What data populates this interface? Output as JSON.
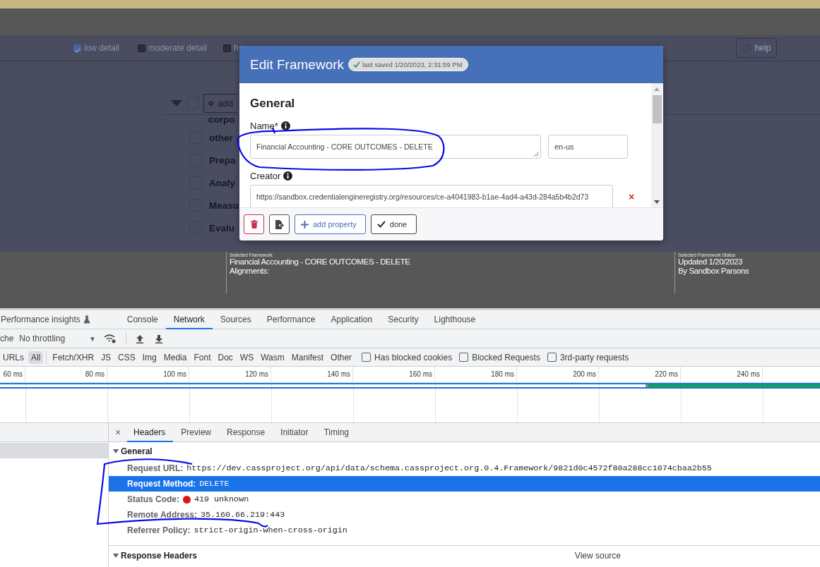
{
  "page_toolbar": {
    "detail_options": [
      {
        "label": "low detail",
        "checked": true
      },
      {
        "label": "moderate detail",
        "checked": false
      },
      {
        "label": "h",
        "checked": false
      }
    ],
    "help_button": "help"
  },
  "tree": {
    "expanded": true,
    "checked": false,
    "add_button": "add",
    "heading": "corpo",
    "items": [
      {
        "label": "other",
        "checked": false
      },
      {
        "label": "Prepa",
        "checked": false
      },
      {
        "label": "Analy",
        "checked": false
      },
      {
        "label": "Measu",
        "checked": false
      },
      {
        "label": "Evalu",
        "checked": false
      }
    ]
  },
  "footer": {
    "selected_framework": {
      "label": "Selected Framework",
      "name": "Financial Accounting - CORE OUTCOMES - DELETE",
      "alignments": "Alignments:"
    },
    "status": {
      "label": "Selected Framework Status",
      "updated": "Updated 1/20/2023",
      "by": "By Sandbox Parsons"
    }
  },
  "modal": {
    "title": "Edit Framework",
    "saved_badge": "last saved 1/20/2023, 2:31:59 PM",
    "section": "General",
    "fields": [
      {
        "kind": "text",
        "label": "Name*",
        "value": "Financial Accounting - CORE OUTCOMES - DELETE",
        "language": "en-us"
      },
      {
        "kind": "url",
        "label": "Creator",
        "value": "https://sandbox.credentialengineregistry.org/resources/ce-a4041983-b1ae-4ad4-a43d-284a5b4b2d73",
        "remove": "×"
      }
    ],
    "buttons": [
      {
        "kind": "delete"
      },
      {
        "kind": "export"
      },
      {
        "kind": "add",
        "label": "add property"
      },
      {
        "kind": "done",
        "label": "done"
      }
    ]
  },
  "devtools": {
    "tabs": [
      {
        "label": "Performance insights",
        "selected": false
      },
      {
        "label": "Console",
        "selected": false
      },
      {
        "label": "Network",
        "selected": true
      },
      {
        "label": "Sources",
        "selected": false
      },
      {
        "label": "Performance",
        "selected": false
      },
      {
        "label": "Application",
        "selected": false
      },
      {
        "label": "Security",
        "selected": false
      },
      {
        "label": "Lighthouse",
        "selected": false
      }
    ],
    "cache_label": "che",
    "throttling": "No throttling",
    "throttling_caret": "▼",
    "filters": [
      {
        "label": "URLs",
        "selected": false
      },
      {
        "label": "All",
        "selected": true
      },
      {
        "label": "Fetch/XHR",
        "selected": false
      },
      {
        "label": "JS",
        "selected": false
      },
      {
        "label": "CSS",
        "selected": false
      },
      {
        "label": "Img",
        "selected": false
      },
      {
        "label": "Media",
        "selected": false
      },
      {
        "label": "Font",
        "selected": false
      },
      {
        "label": "Doc",
        "selected": false
      },
      {
        "label": "WS",
        "selected": false
      },
      {
        "label": "Wasm",
        "selected": false
      },
      {
        "label": "Manifest",
        "selected": false
      },
      {
        "label": "Other",
        "selected": false
      }
    ],
    "filter_checks": [
      {
        "label": "Has blocked cookies",
        "checked": false
      },
      {
        "label": "Blocked Requests",
        "checked": false
      },
      {
        "label": "3rd-party requests",
        "checked": false
      }
    ],
    "timeline_ticks": [
      "60 ms",
      "80 ms",
      "100 ms",
      "120 ms",
      "140 ms",
      "160 ms",
      "180 ms",
      "200 ms",
      "220 ms",
      "240 ms"
    ],
    "close": "×",
    "detail_tabs": [
      {
        "label": "Headers",
        "selected": true
      },
      {
        "label": "Preview",
        "selected": false
      },
      {
        "label": "Response",
        "selected": false
      },
      {
        "label": "Initiator",
        "selected": false
      },
      {
        "label": "Timing",
        "selected": false
      }
    ],
    "general": {
      "title": "General",
      "expanded": true,
      "rows": [
        {
          "kind": "plain",
          "name": "Request URL:",
          "value": "https://dev.cassproject.org/api/data/schema.cassproject.org.0.4.Framework/9821d0c4572f80a288cc1074cbaa2b55",
          "selected": false
        },
        {
          "kind": "plain",
          "name": "Request Method:",
          "value": "DELETE",
          "selected": true
        },
        {
          "kind": "status",
          "name": "Status Code:",
          "value": "419 unknown",
          "selected": false
        },
        {
          "kind": "plain",
          "name": "Remote Address:",
          "value": "35.160.66.219:443",
          "selected": false
        },
        {
          "kind": "plain",
          "name": "Referrer Policy:",
          "value": "strict-origin-when-cross-origin",
          "selected": false
        }
      ]
    },
    "response_headers": {
      "title": "Response Headers",
      "expanded": true,
      "view_source": "View source"
    }
  }
}
